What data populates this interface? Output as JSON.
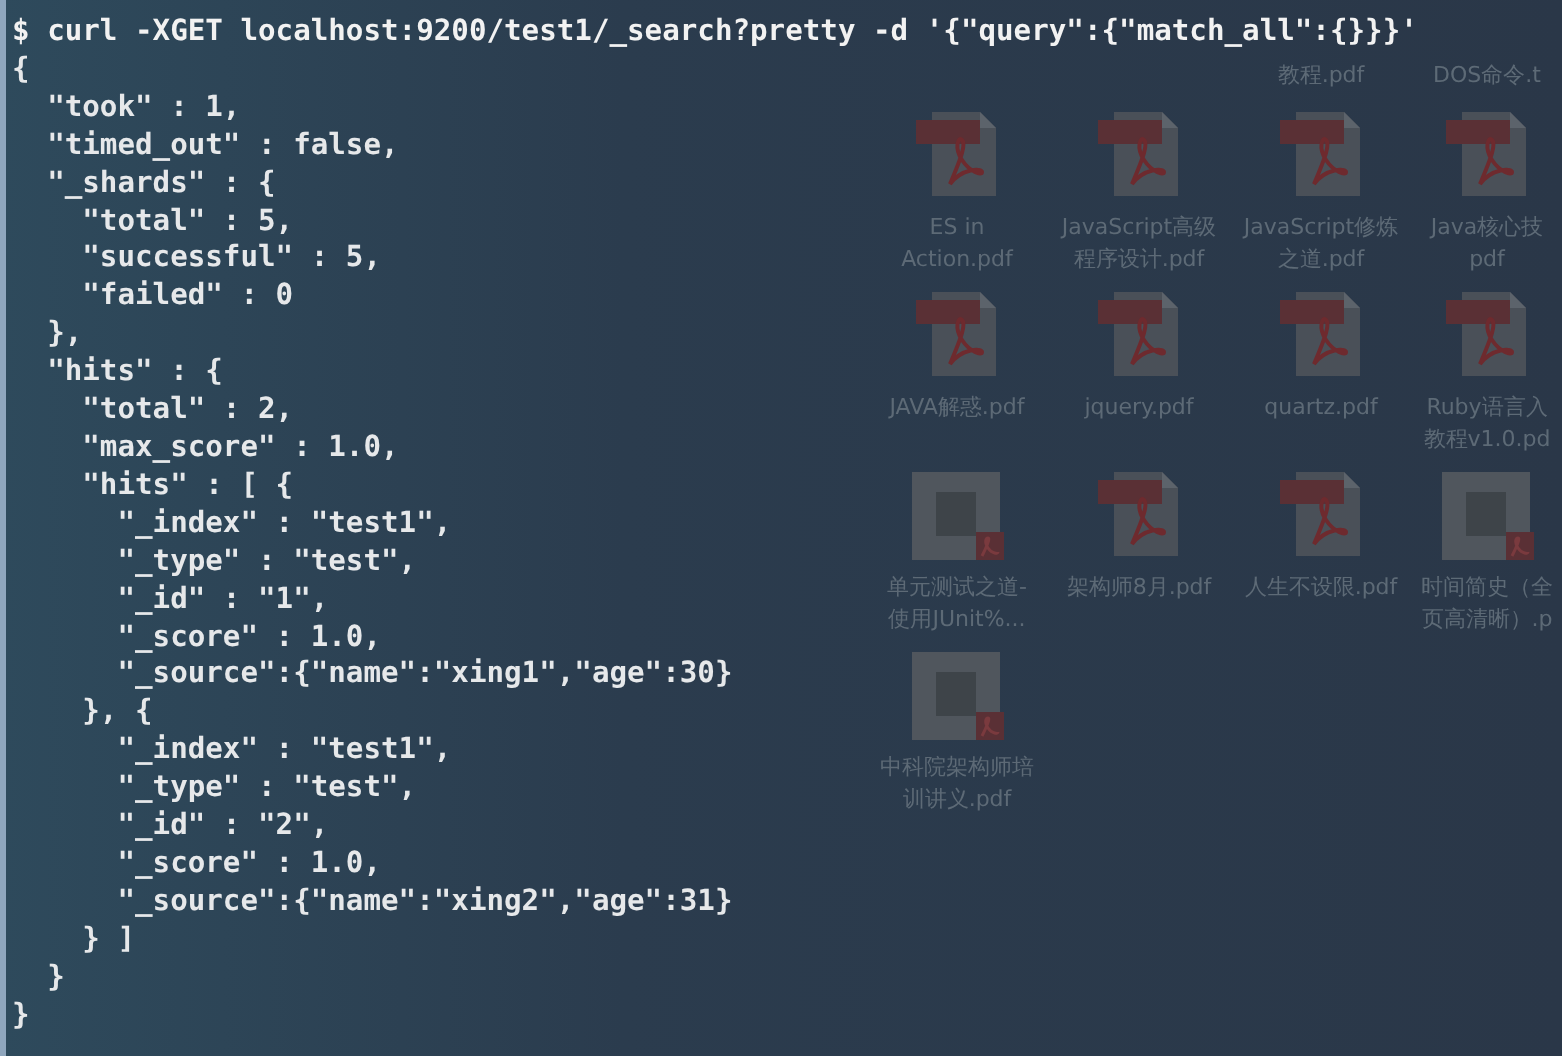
{
  "desktop": {
    "items": [
      {
        "kind": "none"
      },
      {
        "kind": "none"
      },
      {
        "kind": "none",
        "label": [
          "教程.pdf"
        ]
      },
      {
        "kind": "none",
        "label": [
          "DOS命令.t"
        ]
      },
      {
        "kind": "pdf",
        "label": [
          "ES in",
          "Action.pdf"
        ]
      },
      {
        "kind": "pdf",
        "label": [
          "JavaScript高级",
          "程序设计.pdf"
        ]
      },
      {
        "kind": "pdf",
        "label": [
          "JavaScript修炼",
          "之道.pdf"
        ]
      },
      {
        "kind": "pdf",
        "label": [
          "Java核心技",
          "pdf"
        ]
      },
      {
        "kind": "pdf",
        "label": [
          "JAVA解惑.pdf"
        ]
      },
      {
        "kind": "pdf",
        "label": [
          "jquery.pdf"
        ]
      },
      {
        "kind": "pdf",
        "label": [
          "quartz.pdf"
        ]
      },
      {
        "kind": "pdf",
        "label": [
          "Ruby语言入",
          "教程v1.0.pd"
        ]
      },
      {
        "kind": "document",
        "label": [
          "单元测试之道-",
          "使用JUnit%..."
        ]
      },
      {
        "kind": "pdf",
        "label": [
          "架构师8月.pdf"
        ]
      },
      {
        "kind": "pdf",
        "label": [
          "人生不设限.pdf"
        ]
      },
      {
        "kind": "document",
        "label": [
          "时间简史（全",
          "页高清晰）.p"
        ]
      },
      {
        "kind": "document",
        "label": [
          "中科院架构师培",
          "训讲义.pdf"
        ]
      }
    ]
  },
  "terminal": {
    "lines": [
      {
        "kind": "command",
        "text": "$ curl -XGET localhost:9200/test1/_search?pretty -d '{\"query\":{\"match_all\":{}}}'"
      },
      {
        "kind": "output",
        "text": "{"
      },
      {
        "kind": "output",
        "text": "  \"took\" : 1,"
      },
      {
        "kind": "output",
        "text": "  \"timed_out\" : false,"
      },
      {
        "kind": "output",
        "text": "  \"_shards\" : {"
      },
      {
        "kind": "output",
        "text": "    \"total\" : 5,"
      },
      {
        "kind": "output",
        "text": "    \"successful\" : 5,"
      },
      {
        "kind": "output",
        "text": "    \"failed\" : 0"
      },
      {
        "kind": "output",
        "text": "  },"
      },
      {
        "kind": "output",
        "text": "  \"hits\" : {"
      },
      {
        "kind": "output",
        "text": "    \"total\" : 2,"
      },
      {
        "kind": "output",
        "text": "    \"max_score\" : 1.0,"
      },
      {
        "kind": "output",
        "text": "    \"hits\" : [ {"
      },
      {
        "kind": "output",
        "text": "      \"_index\" : \"test1\","
      },
      {
        "kind": "output",
        "text": "      \"_type\" : \"test\","
      },
      {
        "kind": "output",
        "text": "      \"_id\" : \"1\","
      },
      {
        "kind": "output",
        "text": "      \"_score\" : 1.0,"
      },
      {
        "kind": "output",
        "text": "      \"_source\":{\"name\":\"xing1\",\"age\":30}"
      },
      {
        "kind": "output",
        "text": "    }, {"
      },
      {
        "kind": "output",
        "text": "      \"_index\" : \"test1\","
      },
      {
        "kind": "output",
        "text": "      \"_type\" : \"test\","
      },
      {
        "kind": "output",
        "text": "      \"_id\" : \"2\","
      },
      {
        "kind": "output",
        "text": "      \"_score\" : 1.0,"
      },
      {
        "kind": "output",
        "text": "      \"_source\":{\"name\":\"xing2\",\"age\":31}"
      },
      {
        "kind": "output",
        "text": "    } ]"
      },
      {
        "kind": "output",
        "text": "  }"
      },
      {
        "kind": "output",
        "text": "}"
      }
    ]
  }
}
